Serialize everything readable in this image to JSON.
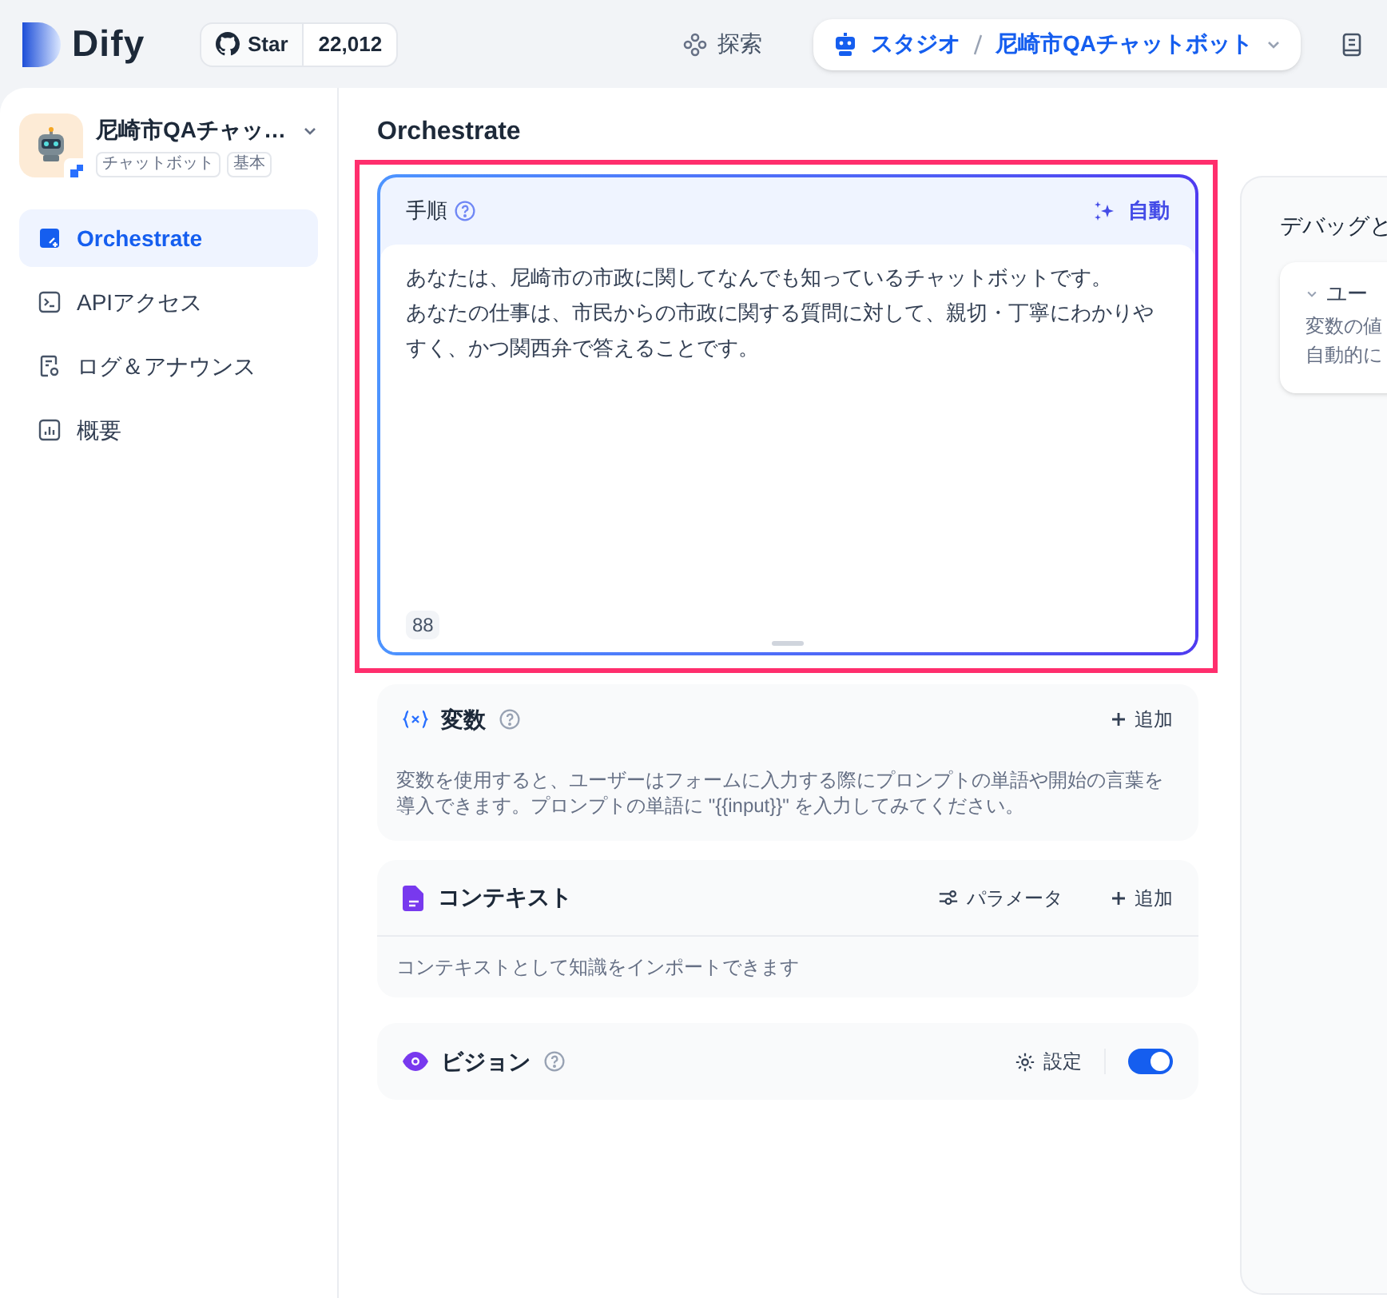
{
  "header": {
    "logo": "Dify",
    "github": {
      "label": "Star",
      "count": "22,012"
    },
    "nav": [
      {
        "label": "探索",
        "selected": false
      },
      {
        "label": "スタジオ",
        "selected": true,
        "app": "尼崎市QAチャットボット"
      }
    ]
  },
  "app": {
    "name": "尼崎市QAチャッ…",
    "tags": [
      "チャットボット",
      "基本"
    ]
  },
  "sidebar": {
    "items": [
      {
        "label": "Orchestrate",
        "selected": true
      },
      {
        "label": "APIアクセス",
        "selected": false
      },
      {
        "label": "ログ＆アナウンス",
        "selected": false
      },
      {
        "label": "概要",
        "selected": false
      }
    ]
  },
  "page_title": "Orchestrate",
  "prompt": {
    "title": "手順",
    "auto_button": "自動",
    "lines": [
      "あなたは、尼崎市の市政に関してなんでも知っているチャットボットです。",
      "あなたの仕事は、市民からの市政に関する質問に対して、親切・丁寧にわかりやすく、かつ関西弁で答えることです。"
    ],
    "count": "88"
  },
  "variables": {
    "title": "変数",
    "add": "追加",
    "description": "変数を使用すると、ユーザーはフォームに入力する際にプロンプトの単語や開始の言葉を導入できます。プロンプトの単語に \"{{input}}\" を入力してみてください。"
  },
  "context": {
    "title": "コンテキスト",
    "params": "パラメータ",
    "add": "追加",
    "description": "コンテキストとして知識をインポートできます"
  },
  "vision": {
    "title": "ビジョン",
    "settings": "設定",
    "on": true
  },
  "debug": {
    "title": "デバッグと",
    "section": "ユー",
    "lines": [
      "変数の値",
      "自動的に"
    ]
  }
}
